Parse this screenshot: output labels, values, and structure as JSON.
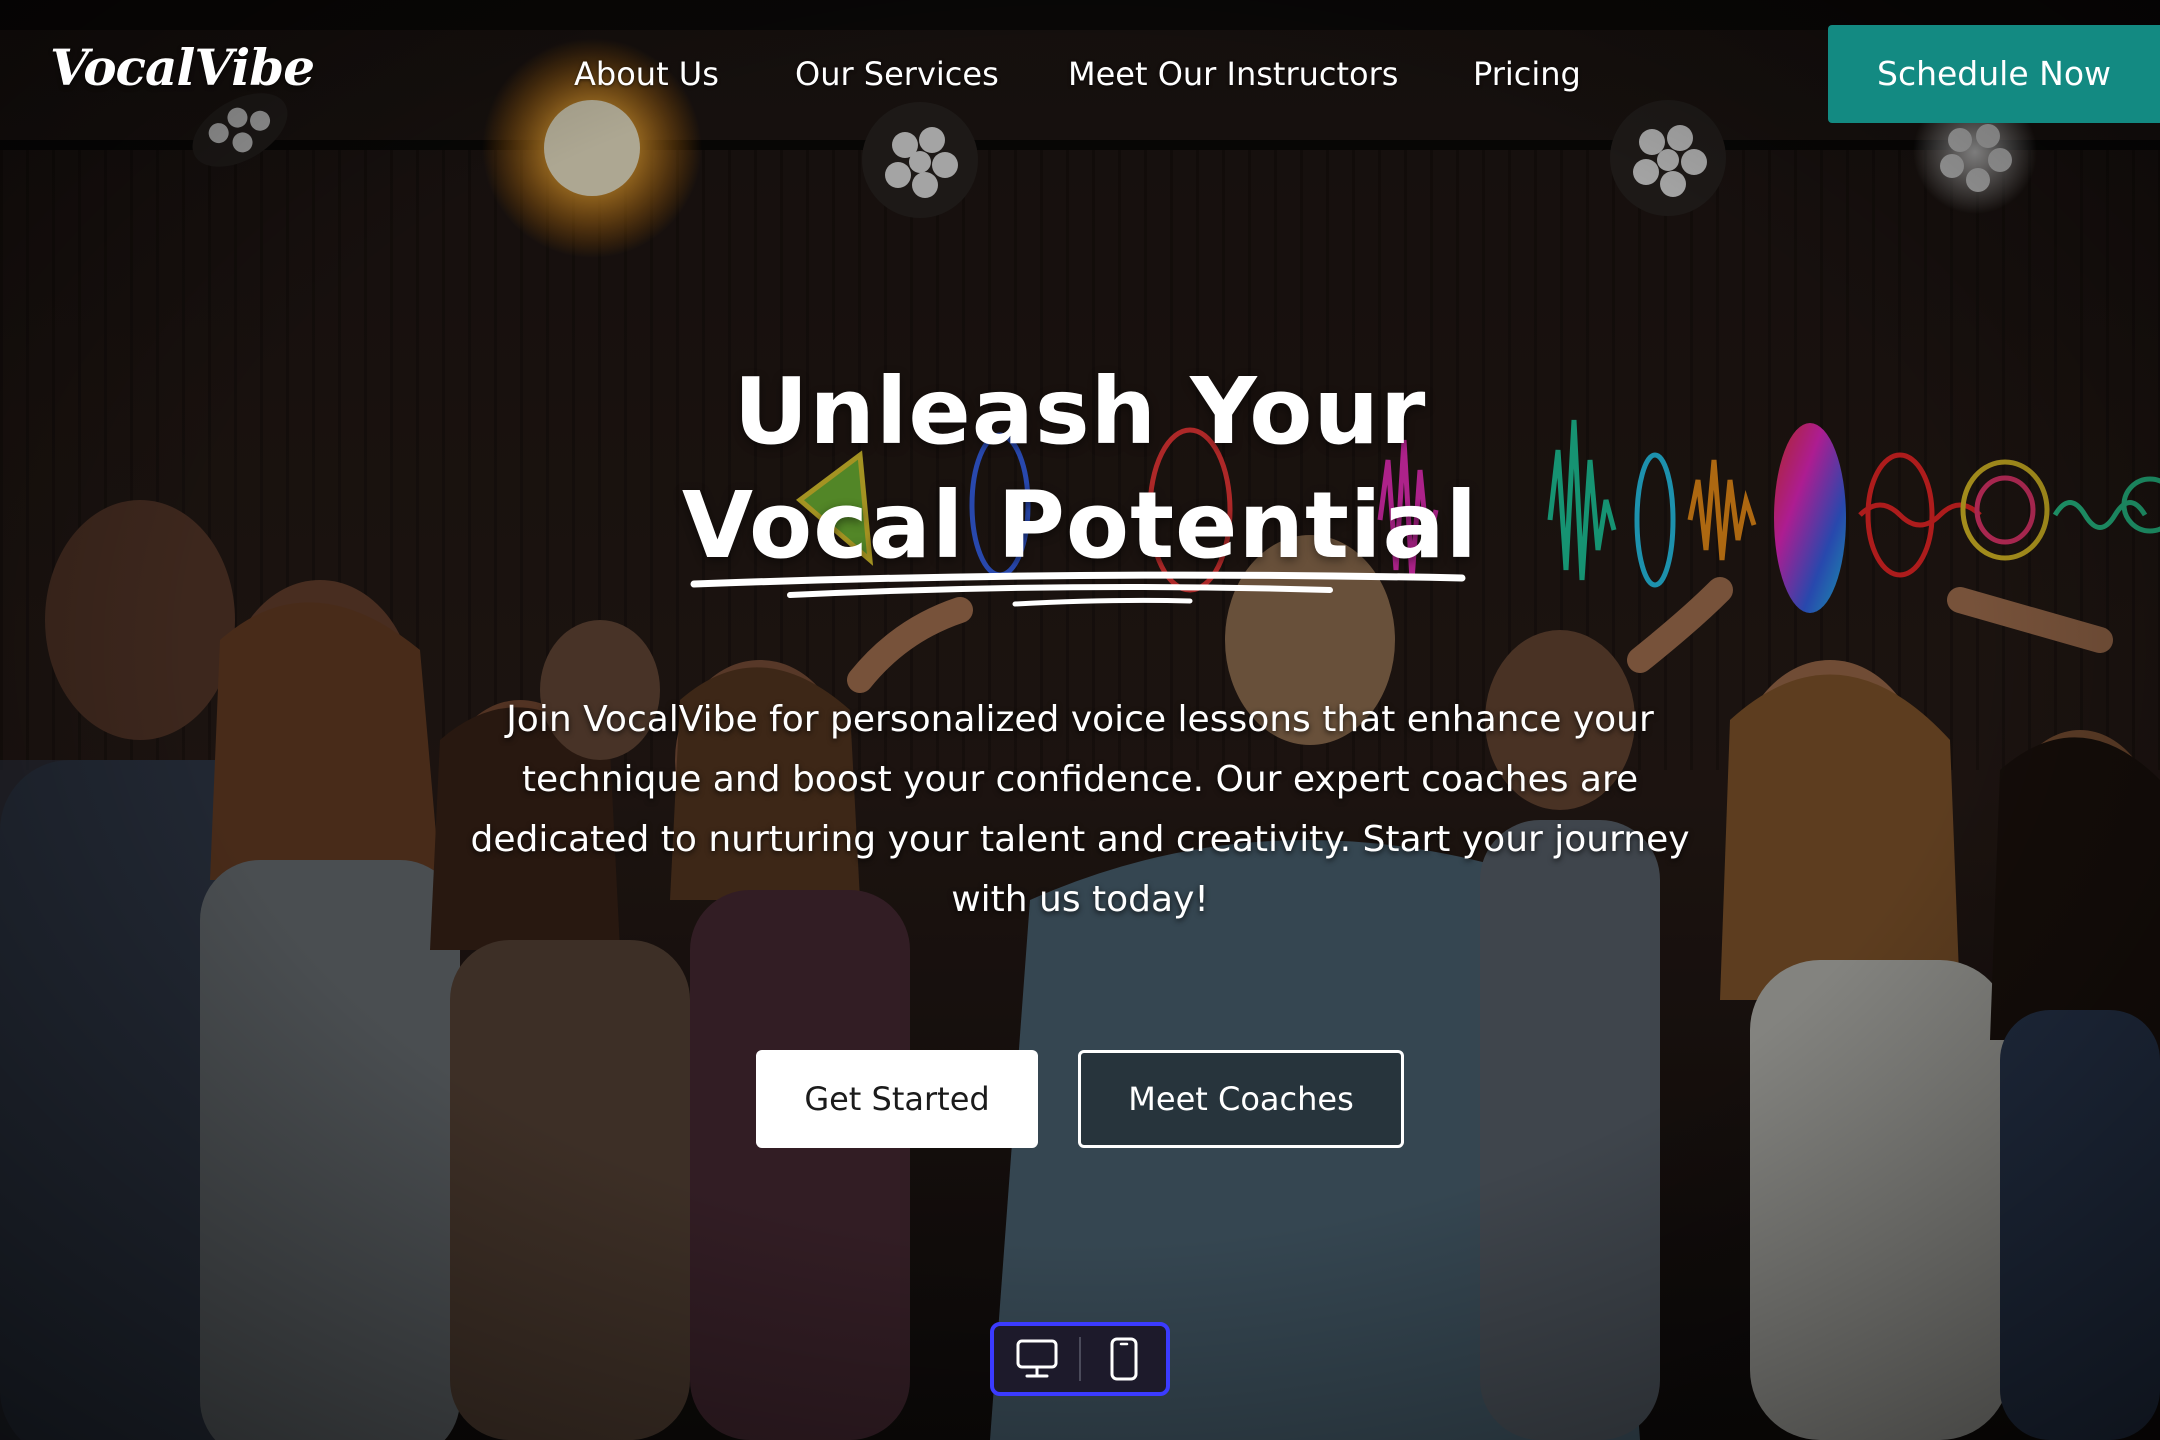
{
  "brand": {
    "logo_text": "VocalVibe",
    "accent_color": "#138a82"
  },
  "nav": {
    "items": [
      {
        "label": "About Us"
      },
      {
        "label": "Our Services"
      },
      {
        "label": "Meet Our Instructors"
      },
      {
        "label": "Pricing"
      }
    ],
    "cta_label": "Schedule Now"
  },
  "hero": {
    "title_line1": "Unleash Your",
    "title_line2": "Vocal Potential",
    "subtitle": "Join VocalVibe for personalized voice lessons that enhance your technique and boost your confidence. Our expert coaches are dedicated to nurturing your talent and creativity. Start your journey with us today!",
    "primary_button": "Get Started",
    "secondary_button": "Meet Coaches"
  },
  "device_toggle": {
    "options": [
      {
        "icon": "desktop-icon"
      },
      {
        "icon": "mobile-icon"
      }
    ],
    "border_color": "#3b3bff"
  }
}
